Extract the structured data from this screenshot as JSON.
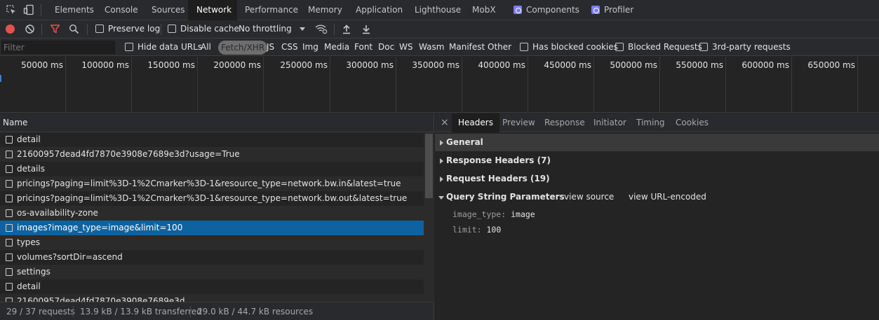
{
  "tabbar": {
    "tabs": [
      {
        "label": "Elements"
      },
      {
        "label": "Console"
      },
      {
        "label": "Sources"
      },
      {
        "label": "Network"
      },
      {
        "label": "Performance"
      },
      {
        "label": "Memory"
      },
      {
        "label": "Application"
      },
      {
        "label": "Lighthouse"
      },
      {
        "label": "MobX"
      },
      {
        "label": "Components"
      },
      {
        "label": "Profiler"
      }
    ],
    "active": "Network"
  },
  "toolbar": {
    "preserve_log": "Preserve log",
    "disable_cache": "Disable cache",
    "throttling": "No throttling"
  },
  "filter": {
    "placeholder": "Filter",
    "hide_data_urls": "Hide data URLs",
    "types": [
      "All",
      "Fetch/XHR",
      "JS",
      "CSS",
      "Img",
      "Media",
      "Font",
      "Doc",
      "WS",
      "Wasm",
      "Manifest",
      "Other"
    ],
    "selected_type": "Fetch/XHR",
    "has_blocked_cookies": "Has blocked cookies",
    "blocked_requests": "Blocked Requests",
    "third_party": "3rd-party requests"
  },
  "timeline": {
    "ticks": [
      "50000 ms",
      "100000 ms",
      "150000 ms",
      "200000 ms",
      "250000 ms",
      "300000 ms",
      "350000 ms",
      "400000 ms",
      "450000 ms",
      "500000 ms",
      "550000 ms",
      "600000 ms",
      "650000 ms"
    ]
  },
  "requests": {
    "column_name": "Name",
    "rows": [
      "detail",
      "21600957dead4fd7870e3908e7689e3d?usage=True",
      "details",
      "pricings?paging=limit%3D-1%2Cmarker%3D-1&resource_type=network.bw.in&latest=true",
      "pricings?paging=limit%3D-1%2Cmarker%3D-1&resource_type=network.bw.out&latest=true",
      "os-availability-zone",
      "images?image_type=image&limit=100",
      "types",
      "volumes?sortDir=ascend",
      "settings",
      "detail",
      "21600957dead4fd7870e3908e7689e3d"
    ],
    "selected_index": 6
  },
  "status": {
    "requests": "29 / 37 requests",
    "transferred": "13.9 kB / 13.9 kB transferred",
    "resources": "29.0 kB / 44.7 kB resources"
  },
  "detail_tabs": {
    "close": "×",
    "tabs": [
      "Headers",
      "Preview",
      "Response",
      "Initiator",
      "Timing",
      "Cookies"
    ],
    "active": "Headers"
  },
  "headers": {
    "general": "General",
    "response_headers": "Response Headers (7)",
    "request_headers": "Request Headers (19)",
    "query_string": "Query String Parameters",
    "view_source": "view source",
    "view_url_encoded": "view URL-encoded",
    "params": [
      {
        "key": "image_type:",
        "value": "image"
      },
      {
        "key": "limit:",
        "value": "100"
      }
    ]
  },
  "colors": {
    "selected_row": "#0e62a0",
    "record_button": "#e2534e",
    "filter_icon": "#e2534e"
  }
}
